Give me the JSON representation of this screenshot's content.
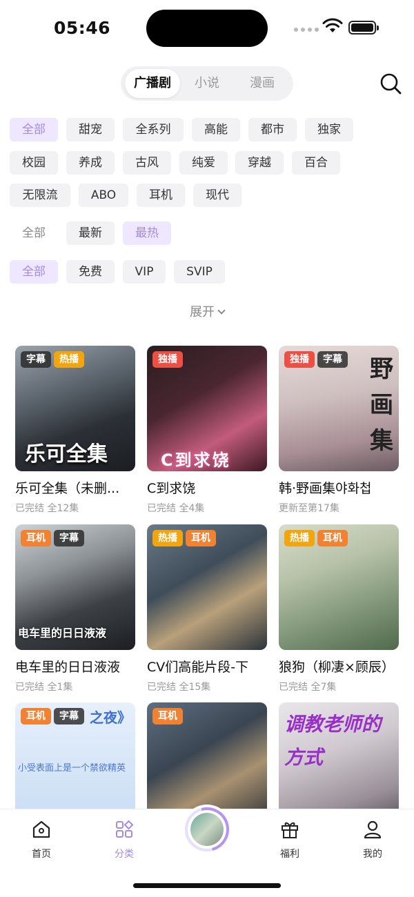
{
  "status": {
    "time": "05:46"
  },
  "tabs": {
    "items": [
      "广播剧",
      "小说",
      "漫画"
    ],
    "active": 0
  },
  "filters": {
    "genres": [
      "全部",
      "甜宠",
      "全系列",
      "高能",
      "都市",
      "独家",
      "校园",
      "养成",
      "古风",
      "纯爱",
      "穿越",
      "百合",
      "无限流",
      "ABO",
      "耳机",
      "现代"
    ],
    "sort": [
      "全部",
      "最新",
      "最热"
    ],
    "price": [
      "全部",
      "免费",
      "VIP",
      "SVIP"
    ],
    "expand_label": "展开"
  },
  "cards": [
    {
      "badges": [
        "字幕",
        "热播"
      ],
      "cover_text": "乐可全集",
      "title": "乐可全集（未删...",
      "meta": "已完结 全12集"
    },
    {
      "badges": [
        "独播"
      ],
      "cover_text": "C到求饶",
      "title": "C到求饶",
      "meta": "已完结 全4集"
    },
    {
      "badges": [
        "独播",
        "字幕"
      ],
      "cover_text": "野画集",
      "title": "韩·野画集야화첩",
      "meta": "更新至第17集"
    },
    {
      "badges": [
        "耳机",
        "字幕"
      ],
      "cover_text": "电车里的日日液液",
      "title": "电车里的日日液液",
      "meta": "已完结 全1集"
    },
    {
      "badges": [
        "热播",
        "耳机"
      ],
      "cover_text": "",
      "title": "CV们高能片段-下",
      "meta": "已完结 全15集"
    },
    {
      "badges": [
        "热播",
        "耳机"
      ],
      "cover_text": "",
      "title": "狼狗（柳凄×顾辰）",
      "meta": "已完结 全7集"
    },
    {
      "badges": [
        "耳机",
        "字幕"
      ],
      "cover_text": "之夜》",
      "cover_sub": "小受表面上是一个禁欲精英",
      "title": "",
      "meta": ""
    },
    {
      "badges": [
        "耳机"
      ],
      "cover_text": "",
      "title": "",
      "meta": ""
    },
    {
      "badges": [],
      "cover_text": "调教老师的方式",
      "title": "",
      "meta": ""
    }
  ],
  "nav": {
    "items": [
      "首页",
      "分类",
      "福利",
      "我的"
    ],
    "active": 1
  },
  "colors": {
    "accent": "#a58be0",
    "chip_active_bg": "#efe6ff",
    "badge_hot": "#f3a50f",
    "badge_exclusive": "#ec4f43",
    "badge_earphone": "#f08232"
  }
}
